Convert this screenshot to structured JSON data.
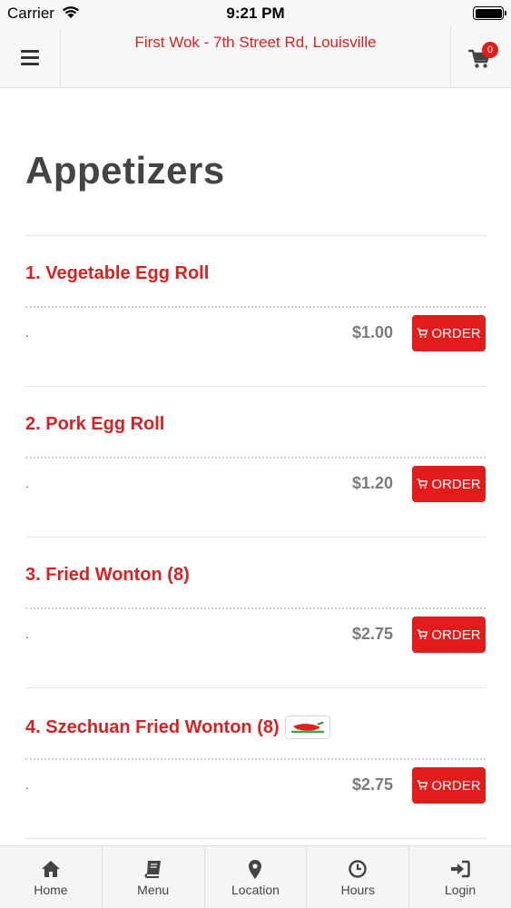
{
  "status_bar": {
    "carrier": "Carrier",
    "time": "9:21 PM"
  },
  "header": {
    "title": "First Wok - 7th Street Rd, Louisville",
    "cart_count": "0"
  },
  "section": {
    "title": "Appetizers"
  },
  "items": [
    {
      "name": "1. Vegetable Egg Roll",
      "description": ".",
      "price": "$1.00",
      "order_label": "ORDER",
      "spicy": false
    },
    {
      "name": "2. Pork Egg Roll",
      "description": ".",
      "price": "$1.20",
      "order_label": "ORDER",
      "spicy": false
    },
    {
      "name": "3. Fried Wonton (8)",
      "description": ".",
      "price": "$2.75",
      "order_label": "ORDER",
      "spicy": false
    },
    {
      "name": "4. Szechuan Fried Wonton (8)",
      "description": ".",
      "price": "$2.75",
      "order_label": "ORDER",
      "spicy": true
    }
  ],
  "tabs": [
    {
      "label": "Home",
      "icon": "home-icon"
    },
    {
      "label": "Menu",
      "icon": "book-icon"
    },
    {
      "label": "Location",
      "icon": "map-pin-icon"
    },
    {
      "label": "Hours",
      "icon": "clock-icon"
    },
    {
      "label": "Login",
      "icon": "login-icon"
    }
  ],
  "colors": {
    "accent": "#d62222",
    "button": "#e41b1b",
    "heading": "#444444",
    "price": "#7b7b7b"
  }
}
